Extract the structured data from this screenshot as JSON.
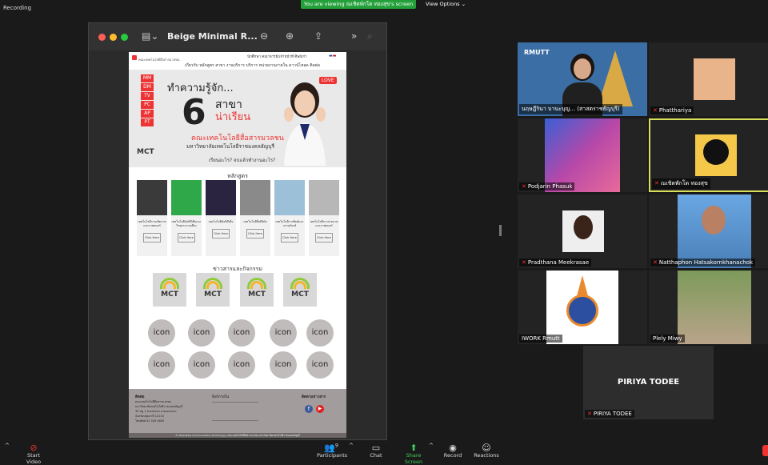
{
  "top": {
    "recording": "Recording",
    "viewing": "You are viewing ณเชิดพักโด  ทองสุข's screen",
    "view_options": "View Options"
  },
  "window": {
    "title": "Beige Minimal R...",
    "colors": {
      "close": "#ff5f57",
      "min": "#febc2e",
      "max": "#28c840"
    }
  },
  "site": {
    "logo_text": "คณะเทคโนโลยีสื่อสารมวลชน",
    "top_links": "นักศึกษา  คณาจารย์/เจ้าหน้าที่  ศิษย์เก่า",
    "nav": "เกี่ยวกับ  หลักสูตร สาขา  งานบริการ  บริการ  หน่วยงานภายใน  ดาวน์โหลด  ติดต่อ",
    "hero": {
      "tags": [
        "MM",
        "DM",
        "TV",
        "PC",
        "AP",
        "PT"
      ],
      "line1": "ทำความรู้จัก...",
      "six": "6",
      "line2": "สาขา",
      "line3": "น่าเรียน",
      "faculty": "คณะเทคโนโลยีสื่อสารมวลชน",
      "university": "มหาวิทยาลัยเทคโนโลยีราชมงคลธัญบุรี",
      "ask": "เรียนอะไร? จบแล้วทำงานอะไร?",
      "love": "LOVE",
      "logo": "MCT"
    },
    "courses_title": "หลักสูตร",
    "courses": [
      {
        "text": "เทคโนโลยีการผลิตภาพและภาพยนตร์",
        "btn": "Click Here",
        "color": "#3a3a3a"
      },
      {
        "text": "เทคโนโลยีมัลติมีเดียและวิทยุกระจายเสียง",
        "btn": "Click Here",
        "color": "#2fa84a"
      },
      {
        "text": "เทคโนโลยีมัลติมีเดีย",
        "btn": "Click Here",
        "color": "#2a2440"
      },
      {
        "text": "เทคโนโลยีสื่อดิจิทัล",
        "btn": "Click Here",
        "color": "#8a8a8a"
      },
      {
        "text": "เทคโนโลยีการพิมพ์และบรรจุภัณฑ์",
        "btn": "Click Here",
        "color": "#9cc0d8"
      },
      {
        "text": "เทคโนโลยีการถ่ายภาพและภาพยนตร์",
        "btn": "Click Here",
        "color": "#b7b7b7"
      }
    ],
    "news_title": "ข่าวสารและกิจกรรม",
    "news_logo": "MCT",
    "icon_label": "icon",
    "footer": {
      "contact_title": "ติดต่อ",
      "contact_lines": [
        "คณะเทคโนโลยีสื่อสารมวลชน",
        "มหาวิทยาลัยเทคโนโลยีราชมงคลธัญบุรี",
        "39 หมู่ 1 ต.คลองหก อ.คลองหลวง",
        "จังหวัดปทุมธานี 12110",
        "โทรศัพท์ 02 549 4600"
      ],
      "links_title": "ลิงก์ภายใน",
      "follow_title": "ติดตามข่าวสาร"
    },
    "copyright": "© 2020 Mass Communication Technology | คณะเทคโนโลยีสื่อสารมวลชน มหาวิทยาลัยเทคโนโลยีราชมงคลธัญบุรี"
  },
  "participants": [
    {
      "name": "นฤษฎีรินา บานะบุญ... (สาสตราชธัญบุรี)",
      "mic_off": false,
      "bg": "#3a6ea5"
    },
    {
      "name": "Phatthariya",
      "mic_off": true,
      "bg": "#232323"
    },
    {
      "name": "Podjarin Phasuk",
      "mic_off": true,
      "bg": "#4a3f8a"
    },
    {
      "name": "ณเชิดพักโด  ทองสุข",
      "mic_off": true,
      "bg": "#232323"
    },
    {
      "name": "Pradthana Meekrasae",
      "mic_off": true,
      "bg": "#232323"
    },
    {
      "name": "Natthaphon Hatsakornkhanachok",
      "mic_off": true,
      "bg": "#5b8fc4"
    },
    {
      "name": "IWORK Rmutt",
      "mic_off": false,
      "bg": "#232323"
    },
    {
      "name": "Plely Miwy",
      "mic_off": false,
      "bg": "#6a7b52"
    },
    {
      "name": "PIRIYA TODEE",
      "mic_off": true,
      "bg": "#2d2d2d"
    }
  ],
  "rmutt_logo": "RMUTT",
  "toolbar": {
    "start_video": "Start Video",
    "participants": "Participants",
    "participants_count": "9",
    "chat": "Chat",
    "share": "Share Screen",
    "record": "Record",
    "reactions": "Reactions"
  }
}
